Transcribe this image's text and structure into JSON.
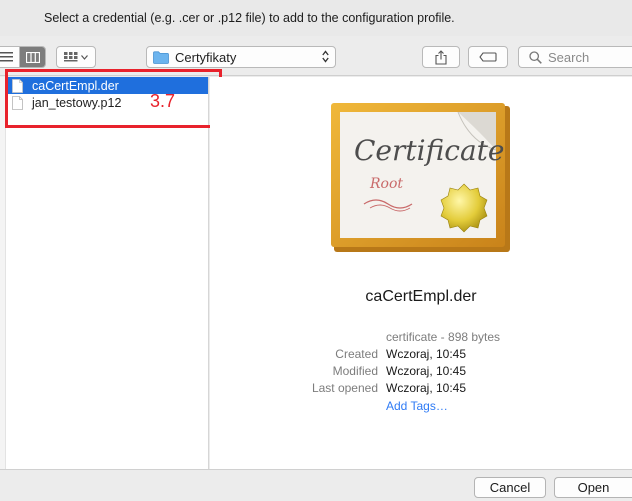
{
  "dialog": {
    "prompt": "Select a credential (e.g. .cer or .p12 file) to add to the configuration profile."
  },
  "toolbar": {
    "view_mode": "columns",
    "current_folder": "Certyfikaty",
    "search_placeholder": "Search"
  },
  "files": [
    {
      "name": "caCertEmpl.der",
      "selected": true
    },
    {
      "name": "jan_testowy.p12",
      "selected": false
    }
  ],
  "annotation": {
    "label": "3.7",
    "color": "#e8222c"
  },
  "preview": {
    "icon_title": "Certificate",
    "icon_subtitle": "Root",
    "file_name": "caCertEmpl.der",
    "kind": "certificate - 898 bytes",
    "created_label": "Created",
    "created_value": "Wczoraj, 10:45",
    "modified_label": "Modified",
    "modified_value": "Wczoraj, 10:45",
    "last_opened_label": "Last opened",
    "last_opened_value": "Wczoraj, 10:45",
    "add_tags": "Add Tags…"
  },
  "buttons": {
    "cancel": "Cancel",
    "open": "Open"
  },
  "colors": {
    "selection": "#1f6fdd",
    "link": "#2f7bf5",
    "annotation": "#e8222c"
  }
}
